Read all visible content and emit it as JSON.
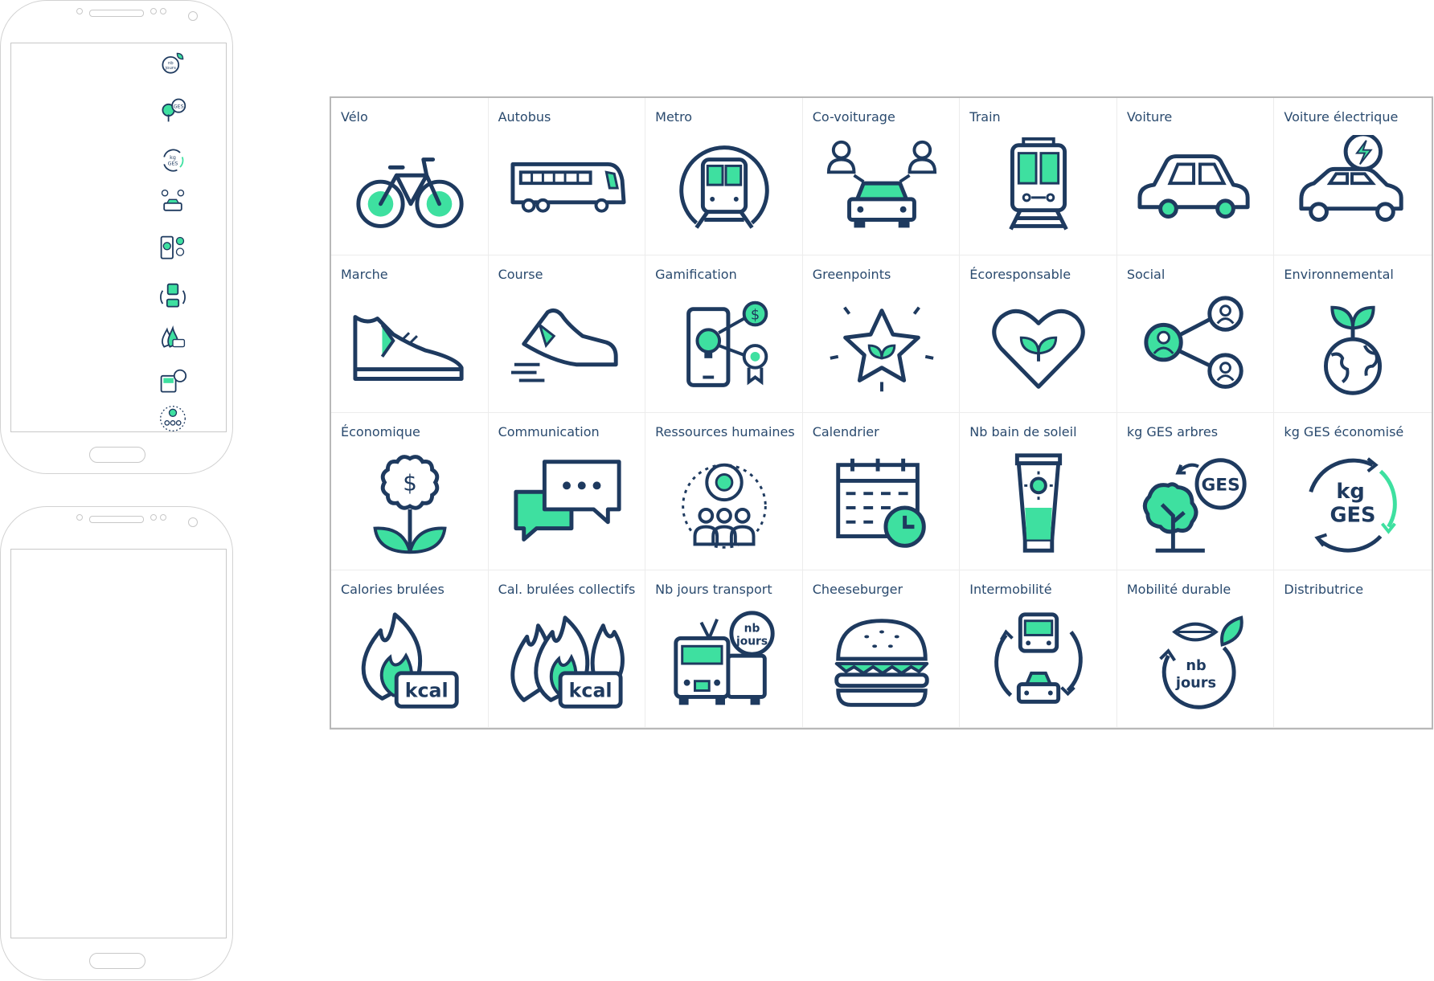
{
  "icons": [
    {
      "label": "Vélo",
      "icon": "bicycle-icon"
    },
    {
      "label": "Autobus",
      "icon": "bus-icon"
    },
    {
      "label": "Metro",
      "icon": "metro-icon"
    },
    {
      "label": "Co-voiturage",
      "icon": "carpool-icon"
    },
    {
      "label": "Train",
      "icon": "train-icon"
    },
    {
      "label": "Voiture",
      "icon": "car-icon"
    },
    {
      "label": "Voiture électrique",
      "icon": "electric-car-icon"
    },
    {
      "label": "Marche",
      "icon": "walking-shoe-icon"
    },
    {
      "label": "Course",
      "icon": "running-shoe-icon"
    },
    {
      "label": "Gamification",
      "icon": "gamification-icon"
    },
    {
      "label": "Greenpoints",
      "icon": "greenpoints-star-icon"
    },
    {
      "label": "Écoresponsable",
      "icon": "eco-heart-icon"
    },
    {
      "label": "Social",
      "icon": "social-network-icon"
    },
    {
      "label": "Environnemental",
      "icon": "earth-sprout-icon"
    },
    {
      "label": "Économique",
      "icon": "money-flower-icon"
    },
    {
      "label": "Communication",
      "icon": "chat-bubbles-icon"
    },
    {
      "label": "Ressources humaines",
      "icon": "human-resources-icon"
    },
    {
      "label": "Calendrier",
      "icon": "calendar-icon"
    },
    {
      "label": "Nb bain de soleil",
      "icon": "sunscreen-icon"
    },
    {
      "label": "kg GES arbres",
      "icon": "tree-ges-icon"
    },
    {
      "label": "kg GES économisé",
      "icon": "kg-ges-cycle-icon"
    },
    {
      "label": "Calories brulées",
      "icon": "flame-kcal-icon"
    },
    {
      "label": "Cal. brulées collectifs",
      "icon": "flames-kcal-collective-icon"
    },
    {
      "label": "Nb jours transport",
      "icon": "bus-nb-jours-icon"
    },
    {
      "label": "Cheeseburger",
      "icon": "cheeseburger-icon"
    },
    {
      "label": "Intermobilité",
      "icon": "intermobility-icon"
    },
    {
      "label": "Mobilité durable",
      "icon": "sustainable-mobility-icon"
    },
    {
      "label": "Distributrice",
      "icon": ""
    }
  ],
  "icon_text": {
    "kcal": "kcal",
    "ges": "GES",
    "kg": "kg",
    "nb": "nb",
    "jours": "jours"
  },
  "phone_mini_icons": [
    "nb-jours-leaf-icon",
    "tree-ges-icon",
    "kg-ges-cycle-icon",
    "carpool-icon",
    "gamification-icon",
    "intermobility-icon",
    "flames-kcal-collective-icon",
    "bus-nb-jours-icon",
    "human-resources-icon"
  ],
  "colors": {
    "navy": "#1e3a5f",
    "green": "#3ee0a0",
    "border": "#b8b8b8"
  }
}
